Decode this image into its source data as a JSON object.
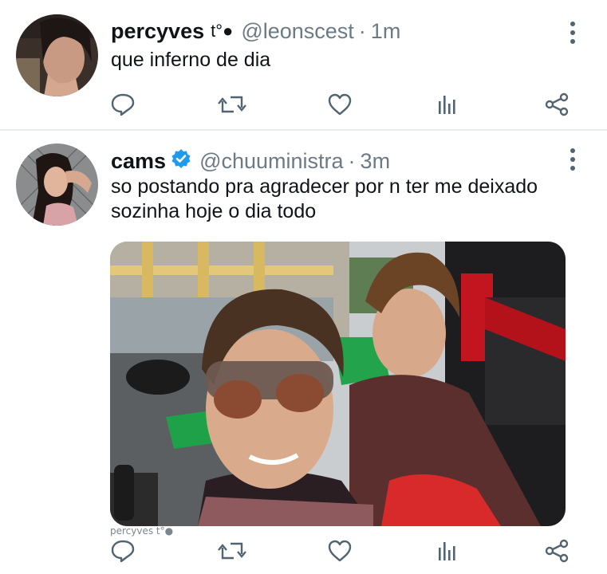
{
  "tweets": [
    {
      "name": "percyves",
      "name_tag": "t°●",
      "handle": "@leonscest",
      "separator": "·",
      "time": "1m",
      "text": "que inferno de dia"
    },
    {
      "name": "cams",
      "handle": "@chuuministra",
      "separator": "·",
      "time": "3m",
      "text_line1": "so postando pra agradecer por n ter me deixado",
      "text_line2": "sozinha hoje o dia todo",
      "watermark": "percyves t°●"
    }
  ],
  "icons": [
    "reply-icon",
    "retweet-icon",
    "like-icon",
    "analytics-icon",
    "share-icon",
    "more-icon",
    "verified-badge-icon"
  ],
  "colors": {
    "icon": "#536471",
    "verified": "#1d9bf0",
    "muted": "#6c7a86",
    "divider": "#e9ecef"
  }
}
